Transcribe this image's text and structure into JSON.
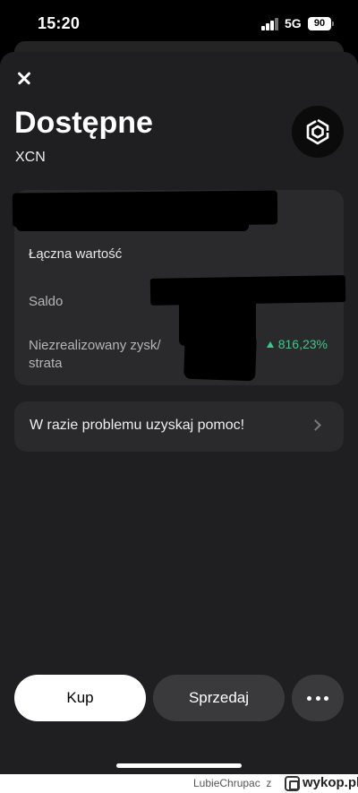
{
  "status_bar": {
    "time": "15:20",
    "network": "5G",
    "battery": "90",
    "signal_icon": "cellular-signal-icon"
  },
  "header": {
    "title": "Dostępne",
    "ticker": "XCN",
    "close_icon": "close-icon",
    "coin_icon": "onyxcoin-logo-icon"
  },
  "info": {
    "total_value_label": "Łączna wartość",
    "balance_label": "Saldo",
    "pnl_label_line1": "Niezrealizowany zysk/",
    "pnl_label_line2": "strata",
    "pnl_percent": "816,23%",
    "pnl_color": "#3cc88a"
  },
  "help": {
    "label": "W razie problemu uzyskaj pomoc!",
    "chevron_icon": "chevron-right-icon"
  },
  "actions": {
    "buy_label": "Kup",
    "sell_label": "Sprzedaj",
    "more_icon": "more-dots-icon"
  },
  "footer": {
    "author": "LubieChrupac",
    "separator": "z",
    "site": "wykop.pl"
  }
}
